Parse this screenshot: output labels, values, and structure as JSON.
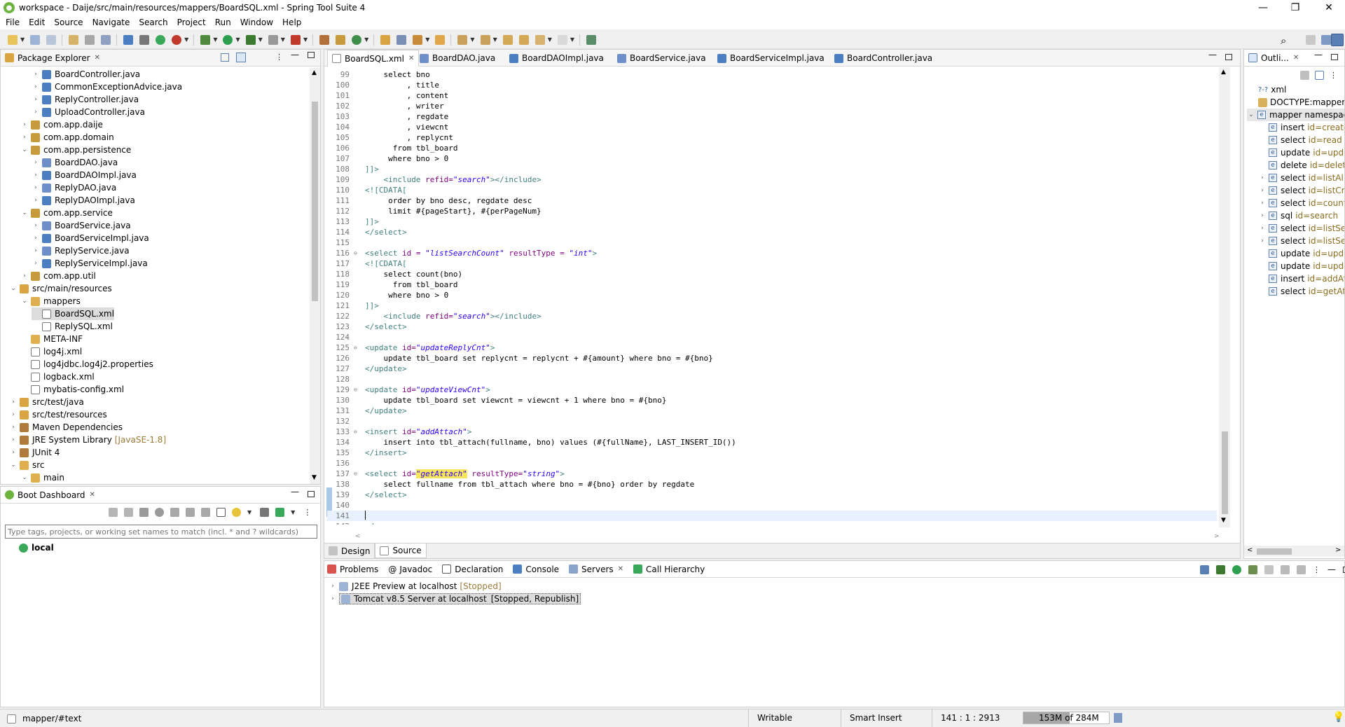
{
  "window": {
    "title": "workspace - Daije/src/main/resources/mappers/BoardSQL.xml - Spring Tool Suite 4",
    "minimize": "—",
    "maximize": "❐",
    "close": "✕"
  },
  "menu": [
    "File",
    "Edit",
    "Source",
    "Navigate",
    "Search",
    "Project",
    "Run",
    "Window",
    "Help"
  ],
  "package_explorer": {
    "title": "Package Explorer",
    "items": [
      {
        "label": "BoardController.java",
        "depth": 3,
        "icon": "java-file-icon",
        "arrow": ">"
      },
      {
        "label": "CommonExceptionAdvice.java",
        "depth": 3,
        "icon": "java-file-icon",
        "arrow": ">"
      },
      {
        "label": "ReplyController.java",
        "depth": 3,
        "icon": "java-file-icon",
        "arrow": ">"
      },
      {
        "label": "UploadController.java",
        "depth": 3,
        "icon": "java-file-icon",
        "arrow": ">"
      },
      {
        "label": "com.app.daije",
        "depth": 2,
        "icon": "package-icon",
        "arrow": ">"
      },
      {
        "label": "com.app.domain",
        "depth": 2,
        "icon": "package-icon",
        "arrow": ">"
      },
      {
        "label": "com.app.persistence",
        "depth": 2,
        "icon": "package-icon",
        "arrow": "v"
      },
      {
        "label": "BoardDAO.java",
        "depth": 3,
        "icon": "java-interface-icon",
        "arrow": ">"
      },
      {
        "label": "BoardDAOImpl.java",
        "depth": 3,
        "icon": "java-file-icon",
        "arrow": ">"
      },
      {
        "label": "ReplyDAO.java",
        "depth": 3,
        "icon": "java-interface-icon",
        "arrow": ">"
      },
      {
        "label": "ReplyDAOImpl.java",
        "depth": 3,
        "icon": "java-file-icon",
        "arrow": ">"
      },
      {
        "label": "com.app.service",
        "depth": 2,
        "icon": "package-icon",
        "arrow": "v"
      },
      {
        "label": "BoardService.java",
        "depth": 3,
        "icon": "java-interface-icon",
        "arrow": ">"
      },
      {
        "label": "BoardServiceImpl.java",
        "depth": 3,
        "icon": "java-file-icon",
        "arrow": ">"
      },
      {
        "label": "ReplyService.java",
        "depth": 3,
        "icon": "java-interface-icon",
        "arrow": ">"
      },
      {
        "label": "ReplyServiceImpl.java",
        "depth": 3,
        "icon": "java-file-icon",
        "arrow": ">"
      },
      {
        "label": "com.app.util",
        "depth": 2,
        "icon": "package-icon",
        "arrow": ">"
      },
      {
        "label": "src/main/resources",
        "depth": 1,
        "icon": "source-folder-icon",
        "arrow": "v"
      },
      {
        "label": "mappers",
        "depth": 2,
        "icon": "folder-icon",
        "arrow": "v"
      },
      {
        "label": "BoardSQL.xml",
        "depth": 3,
        "icon": "xml-file-icon",
        "arrow": "",
        "selected": true
      },
      {
        "label": "ReplySQL.xml",
        "depth": 3,
        "icon": "xml-file-icon",
        "arrow": ""
      },
      {
        "label": "META-INF",
        "depth": 2,
        "icon": "folder-icon",
        "arrow": ""
      },
      {
        "label": "log4j.xml",
        "depth": 2,
        "icon": "xml-file-icon",
        "arrow": ""
      },
      {
        "label": "log4jdbc.log4j2.properties",
        "depth": 2,
        "icon": "properties-file-icon",
        "arrow": ""
      },
      {
        "label": "logback.xml",
        "depth": 2,
        "icon": "xml-file-icon",
        "arrow": ""
      },
      {
        "label": "mybatis-config.xml",
        "depth": 2,
        "icon": "xml-file-icon",
        "arrow": ""
      },
      {
        "label": "src/test/java",
        "depth": 1,
        "icon": "source-folder-icon",
        "arrow": ">"
      },
      {
        "label": "src/test/resources",
        "depth": 1,
        "icon": "source-folder-icon",
        "arrow": ">"
      },
      {
        "label": "Maven Dependencies",
        "depth": 1,
        "icon": "library-icon",
        "arrow": ">"
      },
      {
        "label": "JRE System Library",
        "depth": 1,
        "icon": "library-icon",
        "arrow": ">",
        "extra": "[JavaSE-1.8]"
      },
      {
        "label": "JUnit 4",
        "depth": 1,
        "icon": "library-icon",
        "arrow": ">"
      },
      {
        "label": "src",
        "depth": 1,
        "icon": "folder-icon",
        "arrow": "v"
      },
      {
        "label": "main",
        "depth": 2,
        "icon": "folder-icon",
        "arrow": "v"
      }
    ]
  },
  "boot_dashboard": {
    "title": "Boot Dashboard",
    "filter_placeholder": "Type tags, projects, or working set names to match (incl. * and ? wildcards)",
    "items": [
      "local"
    ]
  },
  "editor": {
    "tabs": [
      "BoardSQL.xml",
      "BoardDAO.java",
      "BoardDAOImpl.java",
      "BoardService.java",
      "BoardServiceImpl.java",
      "BoardController.java"
    ],
    "active_tab": 0,
    "lines": [
      {
        "n": "99",
        "parts": [
          [
            "t",
            "    select bno"
          ]
        ]
      },
      {
        "n": "100",
        "parts": [
          [
            "t",
            "         , title"
          ]
        ]
      },
      {
        "n": "101",
        "parts": [
          [
            "t",
            "         , content"
          ]
        ]
      },
      {
        "n": "102",
        "parts": [
          [
            "t",
            "         , writer"
          ]
        ]
      },
      {
        "n": "103",
        "parts": [
          [
            "t",
            "         , regdate"
          ]
        ]
      },
      {
        "n": "104",
        "parts": [
          [
            "t",
            "         , viewcnt"
          ]
        ]
      },
      {
        "n": "105",
        "parts": [
          [
            "t",
            "         , replycnt"
          ]
        ]
      },
      {
        "n": "106",
        "parts": [
          [
            "t",
            "      from tbl_board"
          ]
        ]
      },
      {
        "n": "107",
        "parts": [
          [
            "t",
            "     where bno > 0"
          ]
        ]
      },
      {
        "n": "108",
        "parts": [
          [
            "c",
            "]]>"
          ]
        ]
      },
      {
        "n": "109",
        "parts": [
          [
            "t",
            "    "
          ],
          [
            "g",
            "<include "
          ],
          [
            "a",
            "refid="
          ],
          [
            "v",
            "\"search\""
          ],
          [
            "g",
            "></include>"
          ]
        ]
      },
      {
        "n": "110",
        "parts": [
          [
            "c",
            "<![CDATA["
          ]
        ]
      },
      {
        "n": "111",
        "parts": [
          [
            "t",
            "     order by bno desc, regdate desc"
          ]
        ]
      },
      {
        "n": "112",
        "parts": [
          [
            "t",
            "     limit #{pageStart}, #{perPageNum}"
          ]
        ]
      },
      {
        "n": "113",
        "parts": [
          [
            "c",
            "]]>"
          ]
        ]
      },
      {
        "n": "114",
        "parts": [
          [
            "g",
            "</select>"
          ]
        ]
      },
      {
        "n": "115",
        "parts": [
          [
            "t",
            ""
          ]
        ]
      },
      {
        "n": "116",
        "fold": true,
        "parts": [
          [
            "g",
            "<select "
          ],
          [
            "a",
            "id = "
          ],
          [
            "v",
            "\"listSearchCount\""
          ],
          [
            "a",
            " resultType = "
          ],
          [
            "v",
            "\"int\""
          ],
          [
            "g",
            ">"
          ]
        ]
      },
      {
        "n": "117",
        "parts": [
          [
            "c",
            "<![CDATA["
          ]
        ]
      },
      {
        "n": "118",
        "parts": [
          [
            "t",
            "    select count(bno)"
          ]
        ]
      },
      {
        "n": "119",
        "parts": [
          [
            "t",
            "      from tbl_board"
          ]
        ]
      },
      {
        "n": "120",
        "parts": [
          [
            "t",
            "     where bno > 0"
          ]
        ]
      },
      {
        "n": "121",
        "parts": [
          [
            "c",
            "]]>"
          ]
        ]
      },
      {
        "n": "122",
        "parts": [
          [
            "t",
            "    "
          ],
          [
            "g",
            "<include "
          ],
          [
            "a",
            "refid="
          ],
          [
            "v",
            "\"search\""
          ],
          [
            "g",
            "></include>"
          ]
        ]
      },
      {
        "n": "123",
        "parts": [
          [
            "g",
            "</select>"
          ]
        ]
      },
      {
        "n": "124",
        "parts": [
          [
            "t",
            ""
          ]
        ]
      },
      {
        "n": "125",
        "fold": true,
        "parts": [
          [
            "g",
            "<update "
          ],
          [
            "a",
            "id="
          ],
          [
            "v",
            "\"updateReplyCnt\""
          ],
          [
            "g",
            ">"
          ]
        ]
      },
      {
        "n": "126",
        "parts": [
          [
            "t",
            "    update tbl_board set replycnt = replycnt + #{amount} where bno = #{bno}"
          ]
        ]
      },
      {
        "n": "127",
        "parts": [
          [
            "g",
            "</update>"
          ]
        ]
      },
      {
        "n": "128",
        "parts": [
          [
            "t",
            ""
          ]
        ]
      },
      {
        "n": "129",
        "fold": true,
        "parts": [
          [
            "g",
            "<update "
          ],
          [
            "a",
            "id="
          ],
          [
            "v",
            "\"updateViewCnt\""
          ],
          [
            "g",
            ">"
          ]
        ]
      },
      {
        "n": "130",
        "parts": [
          [
            "t",
            "    update tbl_board set viewcnt = viewcnt + 1 where bno = #{bno}"
          ]
        ]
      },
      {
        "n": "131",
        "parts": [
          [
            "g",
            "</update>"
          ]
        ]
      },
      {
        "n": "132",
        "parts": [
          [
            "t",
            ""
          ]
        ]
      },
      {
        "n": "133",
        "fold": true,
        "parts": [
          [
            "g",
            "<insert "
          ],
          [
            "a",
            "id="
          ],
          [
            "v",
            "\"addAttach\""
          ],
          [
            "g",
            ">"
          ]
        ]
      },
      {
        "n": "134",
        "parts": [
          [
            "t",
            "    insert into tbl_attach(fullname, bno) values (#{fullName}, LAST_INSERT_ID())"
          ]
        ]
      },
      {
        "n": "135",
        "parts": [
          [
            "g",
            "</insert>"
          ]
        ]
      },
      {
        "n": "136",
        "parts": [
          [
            "t",
            ""
          ]
        ]
      },
      {
        "n": "137",
        "fold": true,
        "parts": [
          [
            "g",
            "<select "
          ],
          [
            "a",
            "id="
          ],
          [
            "h",
            "\"getAttach\""
          ],
          [
            "a",
            " resultType="
          ],
          [
            "v",
            "\"string\""
          ],
          [
            "g",
            ">"
          ]
        ]
      },
      {
        "n": "138",
        "parts": [
          [
            "t",
            "    select fullname from tbl_attach where bno = #{bno} order by regdate"
          ]
        ]
      },
      {
        "n": "139",
        "parts": [
          [
            "g",
            "</select>"
          ]
        ]
      },
      {
        "n": "140",
        "parts": [
          [
            "t",
            ""
          ]
        ]
      },
      {
        "n": "141",
        "parts": [
          [
            "t",
            ""
          ]
        ],
        "current": true
      },
      {
        "n": "142",
        "parts": [
          [
            "g",
            "</mapper>"
          ]
        ]
      }
    ],
    "bottom_tabs": [
      "Design",
      "Source"
    ],
    "active_bottom_tab": 1
  },
  "outline": {
    "title": "Outli...",
    "items": [
      {
        "kind": "pi",
        "label": "xml",
        "prefix": "?-?"
      },
      {
        "kind": "doctype",
        "label": "DOCTYPE:mapper"
      },
      {
        "kind": "root",
        "label": "mapper namespace=..."
      },
      {
        "tag": "insert",
        "id": "id=create"
      },
      {
        "tag": "select",
        "id": "id=read"
      },
      {
        "tag": "update",
        "id": "id=upda..."
      },
      {
        "tag": "delete",
        "id": "id=delete"
      },
      {
        "tag": "select",
        "id": "id=listAll",
        "arrow": true
      },
      {
        "tag": "select",
        "id": "id=listCrit...",
        "arrow": true
      },
      {
        "tag": "select",
        "id": "id=countP...",
        "arrow": true
      },
      {
        "tag": "sql",
        "id": "id=search",
        "arrow": true
      },
      {
        "tag": "select",
        "id": "id=listSea...",
        "arrow": true
      },
      {
        "tag": "select",
        "id": "id=listSea...",
        "arrow": true
      },
      {
        "tag": "update",
        "id": "id=upda..."
      },
      {
        "tag": "update",
        "id": "id=upda..."
      },
      {
        "tag": "insert",
        "id": "id=addAtt..."
      },
      {
        "tag": "select",
        "id": "id=getAtta..."
      }
    ]
  },
  "bottom_panel": {
    "tabs": [
      "Problems",
      "Javadoc",
      "Declaration",
      "Console",
      "Servers",
      "Call Hierarchy"
    ],
    "active_tab": 4,
    "servers": [
      {
        "name": "J2EE Preview at localhost",
        "state": "[Stopped]"
      },
      {
        "name": "Tomcat v8.5 Server at localhost",
        "state": "[Stopped, Republish]"
      }
    ]
  },
  "status": {
    "path": "mapper/#text",
    "writable": "Writable",
    "insert_mode": "Smart Insert",
    "position": "141 : 1 : 2913",
    "memory": "153M of 284M",
    "memory_used_fraction": 0.54
  },
  "colors": {
    "accent_blue": "#2c5aa0",
    "spring_green": "#6db33f",
    "selection": "#dcdcdc"
  }
}
